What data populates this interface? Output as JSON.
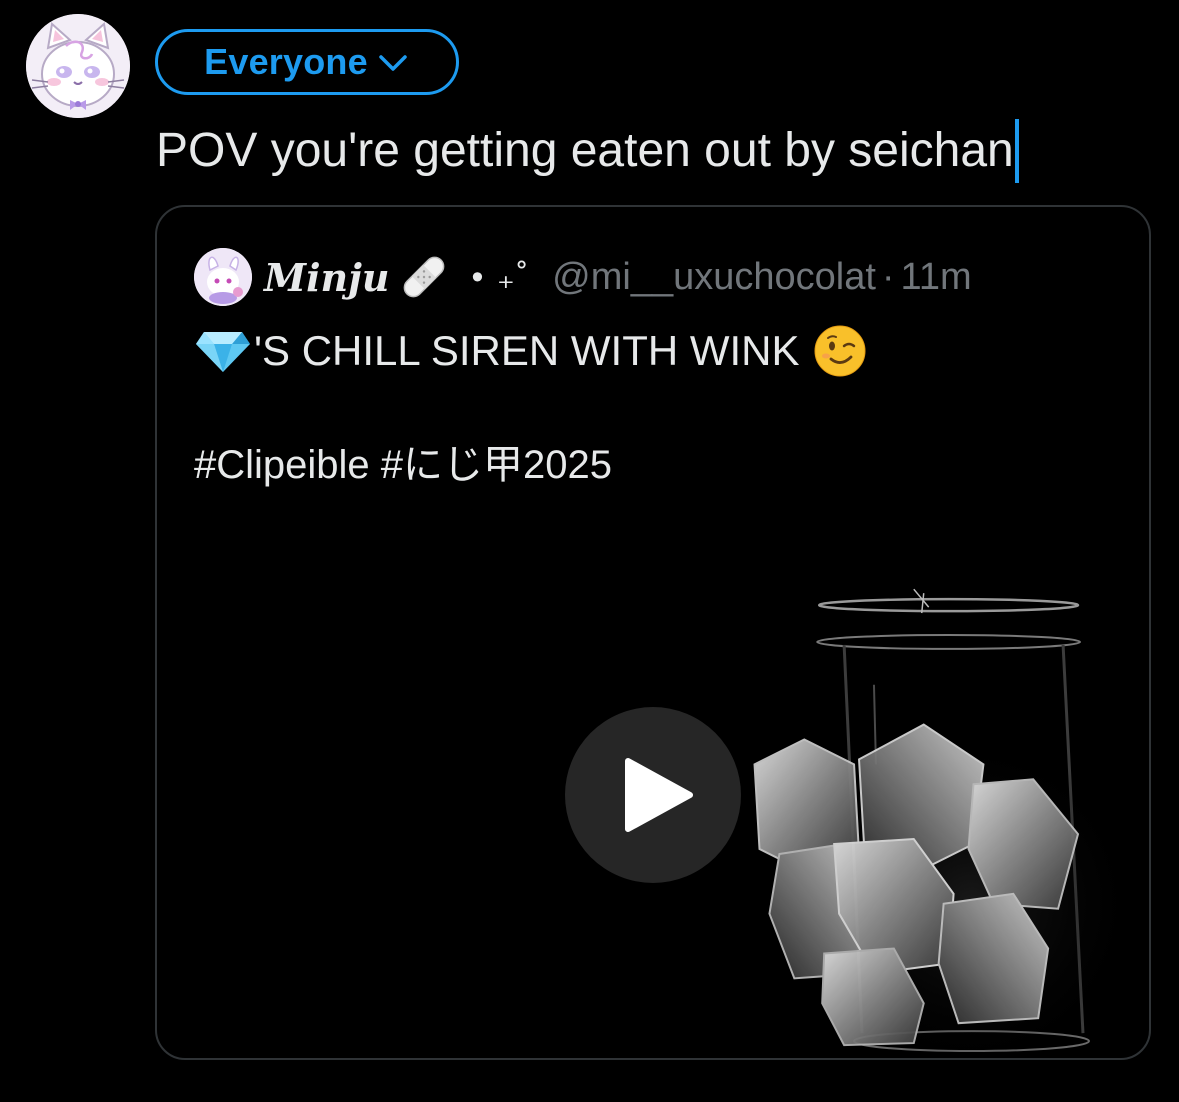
{
  "composer": {
    "audience_label": "Everyone",
    "text": "POV you're getting eaten out by seichan"
  },
  "quote": {
    "display_name": "Minju",
    "name_decoration": "• ₊˚",
    "handle": "@mi__uxuchocolat",
    "separator": "·",
    "timestamp": "11m",
    "line1": "'S CHILL SIREN WITH WINK",
    "hashtags": "#Clipeible #にじ甲2025"
  },
  "colors": {
    "accent": "#1d9bf0",
    "background": "#000000",
    "text": "#e7e9ea",
    "muted": "#71767b",
    "border": "#2f3336"
  },
  "icons": {
    "audience_chevron": "chevron-down-icon",
    "name_emoji": "bandage-icon",
    "line1_prefix_emoji": "gem-icon",
    "line1_suffix_emoji": "wink-emoji-icon",
    "media_control": "play-icon"
  }
}
